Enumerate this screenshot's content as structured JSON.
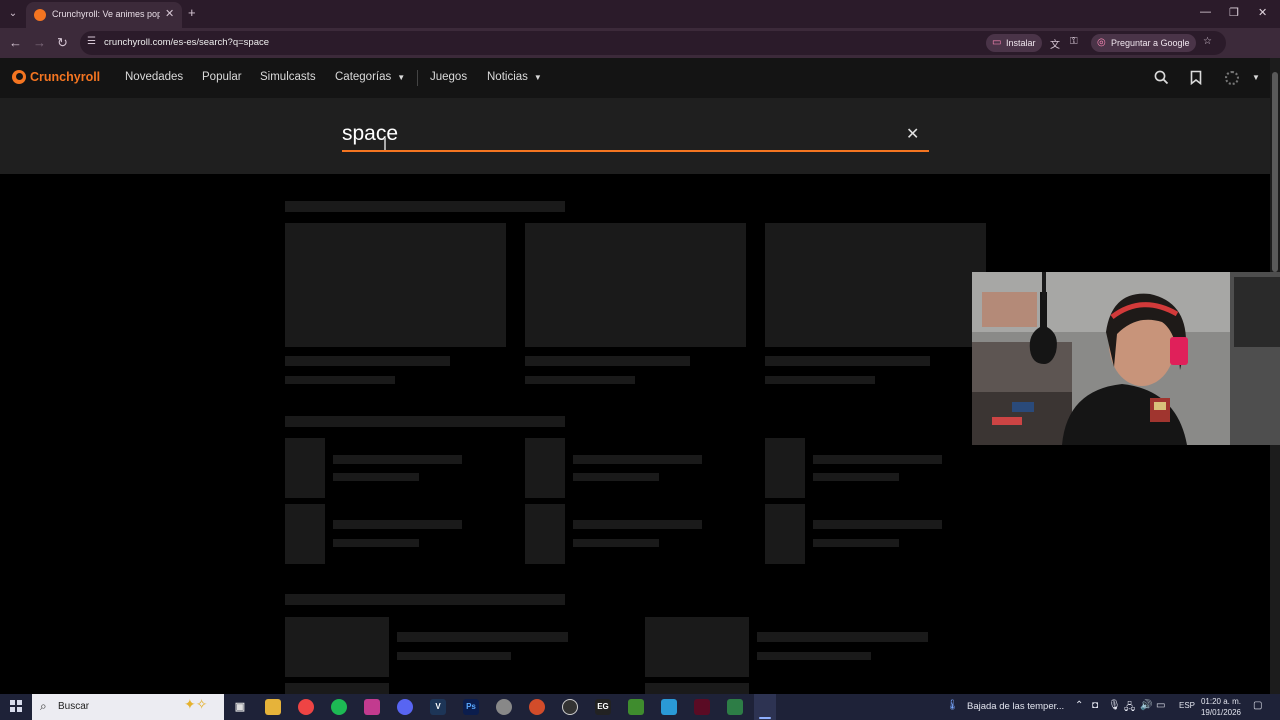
{
  "browser": {
    "tab_title": "Crunchyroll: Ve animes populares",
    "url": "crunchyroll.com/es-es/search?q=space",
    "install_label": "Instalar",
    "ask_google_label": "Preguntar a Google",
    "profile_initial": "M"
  },
  "site": {
    "brand": "Crunchyroll",
    "nav": {
      "novedades": "Novedades",
      "popular": "Popular",
      "simulcasts": "Simulcasts",
      "categorias": "Categorías",
      "juegos": "Juegos",
      "noticias": "Noticias"
    }
  },
  "search": {
    "query": "space"
  },
  "taskbar": {
    "search_placeholder": "Buscar",
    "weather": "Bajada de las temper...",
    "language": "ESP",
    "time": "01:20 a. m.",
    "date": "19/01/2026"
  },
  "colors": {
    "accent": "#f47521",
    "background": "#000000",
    "search_band": "#1f1f1f"
  }
}
